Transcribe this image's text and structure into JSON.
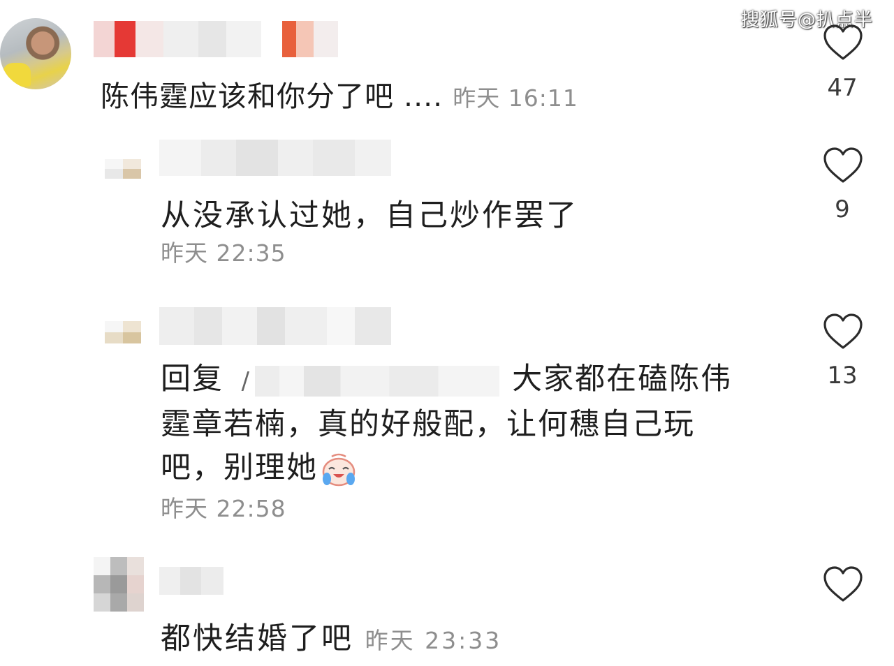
{
  "watermark": "搜狐号@扒点半",
  "comments": [
    {
      "text": "陈伟霆应该和你分了吧 ....",
      "time": "昨天 16:11",
      "likes": "47"
    },
    {
      "text": "从没承认过她，自己炒作罢了",
      "time": "昨天 22:35",
      "likes": "9"
    },
    {
      "reply_prefix": "回复",
      "reply_mention_fragment": "/",
      "text_line1": "大家都在磕陈伟",
      "text_line2": "霆章若楠，真的好般配，让何穗自己玩",
      "text_line3": "吧，别理她",
      "emoji": "crying-laughing-emoji",
      "time": "昨天 22:58",
      "likes": "13"
    },
    {
      "text": "都快结婚了吧",
      "time": "昨天 23:33"
    }
  ],
  "colors": {
    "text": "#1e1e1e",
    "meta": "#8e8e8e",
    "heart_stroke": "#2b2b2b"
  }
}
